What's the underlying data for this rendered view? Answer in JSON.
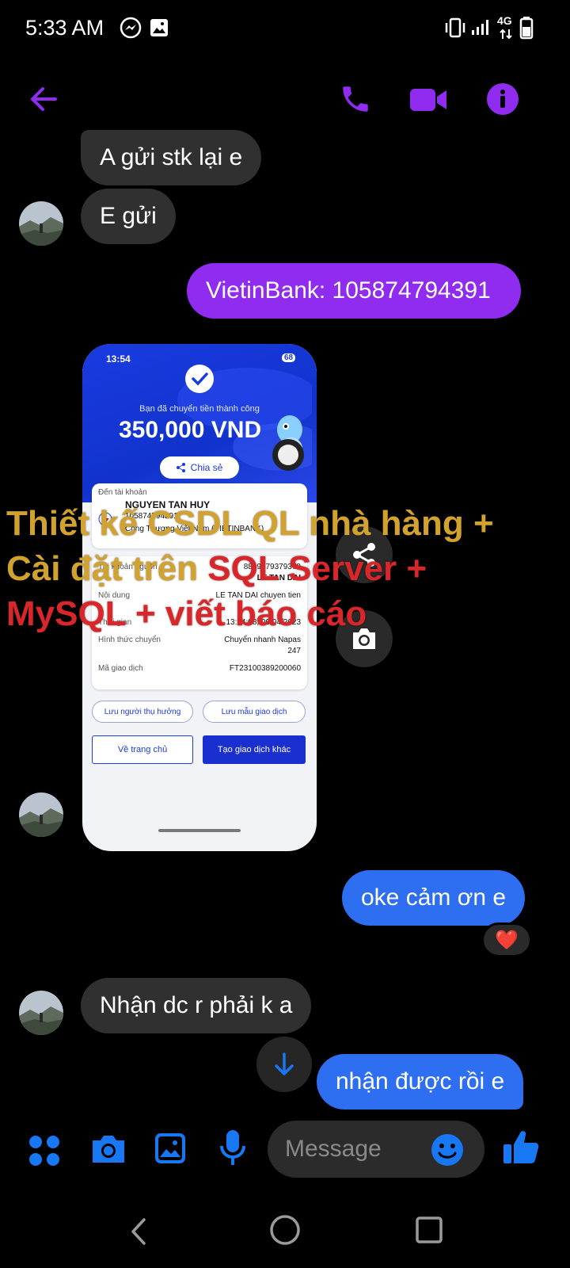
{
  "status_bar": {
    "time": "5:33 AM",
    "network": "4G"
  },
  "header": {
    "back_icon": "arrow-left-icon",
    "call_icon": "phone-icon",
    "video_icon": "video-camera-icon",
    "info_icon": "info-icon"
  },
  "messages": [
    {
      "side": "in",
      "text": "A gửi stk lại e"
    },
    {
      "side": "in",
      "text": "E gửi"
    },
    {
      "side": "out",
      "text": "VietinBank: 105874794391"
    },
    {
      "side": "out",
      "text": "oke cảm ơn e",
      "reaction": "❤️"
    },
    {
      "side": "in",
      "text": "Nhận dc r phải k a"
    },
    {
      "side": "out",
      "text": "nhận được rồi e"
    }
  ],
  "receipt": {
    "time": "13:54",
    "battery": "68",
    "subtitle": "Bạn đã chuyển tiền thành công",
    "amount": "350,000 VND",
    "share": "Chia sẻ",
    "to_account_label": "Đến tài khoản",
    "to_name": "NGUYEN TAN HUY",
    "to_number": "105874794391",
    "to_bank": "Công Thương Việt Nam (VIETINBANK)",
    "from_label": "Tài khoản nguồn",
    "from_number": "8899379379379",
    "from_name": "LE TAN DAI",
    "content_label": "Nội dung",
    "content_value": "LE TAN DAI chuyen tien",
    "time_label": "Thời gian",
    "time_value": "13:54:08, 09/04/2023",
    "method_label": "Hình thức chuyển",
    "method_value_1": "Chuyển nhanh Napas",
    "method_value_2": "247",
    "txn_label": "Mã giao dịch",
    "txn_value": "FT23100389200060",
    "save_payee": "Lưu người thụ hưởng",
    "save_template": "Lưu mẫu giao dịch",
    "home": "Về trang chủ",
    "new_txn": "Tạo giao dịch khác"
  },
  "overlay": {
    "line1": "Thiết kế CSDL QL nhà hàng +",
    "line2a": "Cài đặt trên ",
    "line2b": "SQL Server +",
    "line3": "MySQL + viết báo cáo"
  },
  "composer": {
    "placeholder": "Message"
  },
  "colors": {
    "accent_purple": "#8f2cf0",
    "blue_bubble": "#2e6ef0",
    "icon_blue": "#1877f2",
    "incoming": "#303030"
  }
}
